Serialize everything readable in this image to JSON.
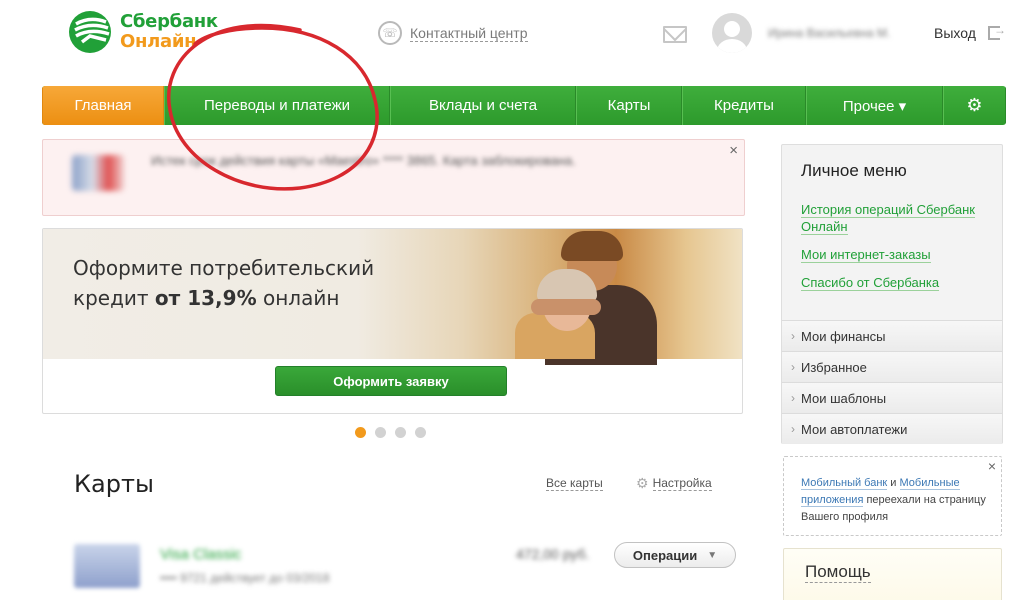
{
  "header": {
    "logo_line1": "Сбербанк",
    "logo_line2": "Онлайн",
    "contact_center": "Контактный центр",
    "username": "Ирина Васильевна М.",
    "logout": "Выход"
  },
  "nav": {
    "items": [
      {
        "label": "Главная",
        "active": true
      },
      {
        "label": "Переводы и платежи"
      },
      {
        "label": "Вклады и счета"
      },
      {
        "label": "Карты"
      },
      {
        "label": "Кредиты"
      },
      {
        "label": "Прочее ▾"
      }
    ],
    "settings_icon": "gear-icon"
  },
  "notification": {
    "text": "Истек срок действия карты «Maestro» **** 3865. Карта заблокирована.",
    "close": "×"
  },
  "promo": {
    "title_line1": "Оформите потребительский",
    "title_line2_prefix": "кредит ",
    "title_line2_bold": "от 13,9%",
    "title_line2_suffix": " онлайн",
    "button": "Оформить заявку",
    "slides": 4,
    "active_slide": 1
  },
  "cards_section": {
    "title": "Карты",
    "all_cards": "Все карты",
    "settings": "Настройка",
    "card": {
      "name": "Visa Classic",
      "number": "•••• 9721 действует до 03/2018",
      "balance": "472,00 руб.",
      "operations_button": "Операции"
    }
  },
  "sidebar": {
    "title": "Личное меню",
    "links": [
      "История операций Сбербанк Онлайн",
      "Мои интернет-заказы",
      "Спасибо от Сбербанка"
    ],
    "sections": [
      "Мои финансы",
      "Избранное",
      "Мои шаблоны",
      "Мои автоплатежи"
    ]
  },
  "mobile_note": {
    "link1": "Мобильный банк",
    "and": " и ",
    "link2": "Мобильные приложения",
    "rest": " переехали на страницу Вашего профиля",
    "close": "×"
  },
  "help": {
    "title": "Помощь"
  },
  "colors": {
    "brand_green": "#21a038",
    "nav_green": "#34a333",
    "active_orange": "#f29a1c",
    "annotation_red": "#d8282e"
  }
}
